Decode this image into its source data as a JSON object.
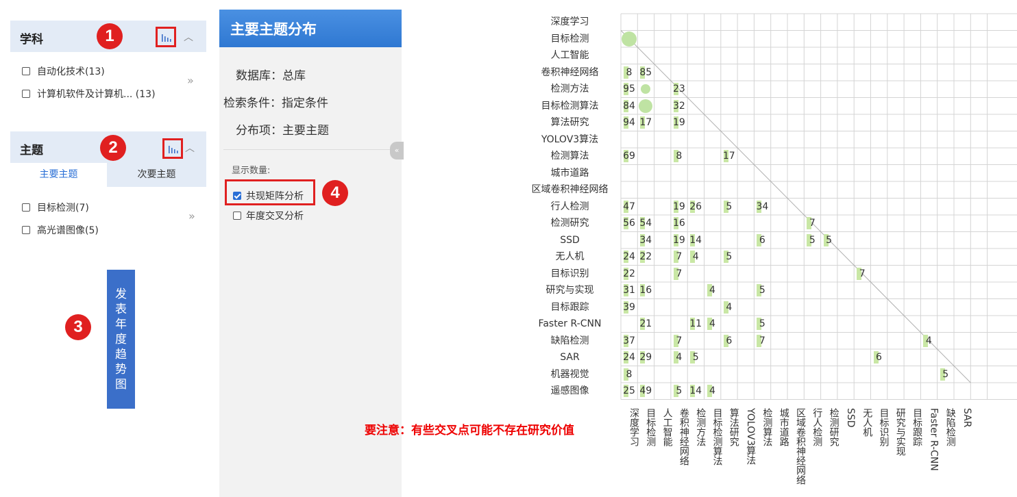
{
  "facets": {
    "subject": {
      "title": "学科",
      "badge": "1",
      "items": [
        "自动化技术(13)",
        "计算机软件及计算机...  (13)"
      ],
      "more": "»"
    },
    "topic": {
      "title": "主题",
      "badge": "2",
      "tabs": [
        "主要主题",
        "次要主题"
      ],
      "items": [
        "目标检测(7)",
        "高光谱图像(5)"
      ],
      "more": "»"
    }
  },
  "trend_badge": "3",
  "trend_button": "发表年度趋势图",
  "panel": {
    "title": "主要主题分布",
    "info": [
      {
        "label": "数据库：",
        "value": "总库"
      },
      {
        "label": "检索条件：",
        "value": "指定条件"
      },
      {
        "label": "分布项：",
        "value": "主要主题"
      }
    ],
    "count_label": "显示数量:",
    "options": [
      {
        "label": "共现矩阵分析",
        "checked": true
      },
      {
        "label": "年度交叉分析",
        "checked": false
      }
    ],
    "option_badge": "4",
    "collapse_icon": "«"
  },
  "matrix": {
    "rows": [
      "深度学习",
      "目标检测",
      "人工智能",
      "卷积神经网络",
      "检测方法",
      "目标检测算法",
      "算法研究",
      "YOLOV3算法",
      "检测算法",
      "城市道路",
      "区域卷积神经网络",
      "行人检测",
      "检测研究",
      "SSD",
      "无人机",
      "目标识别",
      "研究与实现",
      "目标跟踪",
      "Faster R-CNN",
      "缺陷检测",
      "SAR",
      "机器视觉",
      "遥感图像"
    ],
    "columns": [
      "深度学习",
      "目标检测",
      "人工智能",
      "卷积神经网络",
      "检测方法",
      "目标检测算法",
      "算法研究",
      "YOLOV3算法",
      "检测算法",
      "城市道路",
      "区域卷积神经网络",
      "行人检测",
      "检测研究",
      "SSD",
      "无人机",
      "目标识别",
      "研究与实现",
      "目标跟踪",
      "Faster R-CNN",
      "缺陷检测",
      "SAR"
    ],
    "cells": [
      {
        "row": 1,
        "col": 0,
        "value": null
      },
      {
        "row": 3,
        "col": 0,
        "value": "8"
      },
      {
        "row": 3,
        "col": 1,
        "value": "85"
      },
      {
        "row": 4,
        "col": 0,
        "value": "95"
      },
      {
        "row": 4,
        "col": 1,
        "value": null
      },
      {
        "row": 4,
        "col": 3,
        "value": "23"
      },
      {
        "row": 5,
        "col": 0,
        "value": "84"
      },
      {
        "row": 5,
        "col": 1,
        "value": null
      },
      {
        "row": 5,
        "col": 3,
        "value": "32"
      },
      {
        "row": 6,
        "col": 0,
        "value": "94"
      },
      {
        "row": 6,
        "col": 1,
        "value": "17"
      },
      {
        "row": 6,
        "col": 3,
        "value": "19"
      },
      {
        "row": 8,
        "col": 0,
        "value": "69"
      },
      {
        "row": 8,
        "col": 3,
        "value": "8"
      },
      {
        "row": 8,
        "col": 6,
        "value": "17"
      },
      {
        "row": 11,
        "col": 0,
        "value": "47"
      },
      {
        "row": 11,
        "col": 3,
        "value": "19"
      },
      {
        "row": 11,
        "col": 4,
        "value": "26"
      },
      {
        "row": 11,
        "col": 6,
        "value": "5"
      },
      {
        "row": 11,
        "col": 8,
        "value": "34"
      },
      {
        "row": 12,
        "col": 0,
        "value": "56"
      },
      {
        "row": 12,
        "col": 1,
        "value": "54"
      },
      {
        "row": 12,
        "col": 3,
        "value": "16"
      },
      {
        "row": 12,
        "col": 11,
        "value": "7"
      },
      {
        "row": 13,
        "col": 1,
        "value": "34"
      },
      {
        "row": 13,
        "col": 3,
        "value": "19"
      },
      {
        "row": 13,
        "col": 4,
        "value": "14"
      },
      {
        "row": 13,
        "col": 8,
        "value": "6"
      },
      {
        "row": 13,
        "col": 11,
        "value": "5"
      },
      {
        "row": 13,
        "col": 12,
        "value": "5"
      },
      {
        "row": 14,
        "col": 0,
        "value": "24"
      },
      {
        "row": 14,
        "col": 1,
        "value": "22"
      },
      {
        "row": 14,
        "col": 3,
        "value": "7"
      },
      {
        "row": 14,
        "col": 4,
        "value": "4"
      },
      {
        "row": 14,
        "col": 6,
        "value": "5"
      },
      {
        "row": 15,
        "col": 0,
        "value": "22"
      },
      {
        "row": 15,
        "col": 3,
        "value": "7"
      },
      {
        "row": 15,
        "col": 14,
        "value": "7"
      },
      {
        "row": 16,
        "col": 0,
        "value": "31"
      },
      {
        "row": 16,
        "col": 1,
        "value": "16"
      },
      {
        "row": 16,
        "col": 5,
        "value": "4"
      },
      {
        "row": 16,
        "col": 8,
        "value": "5"
      },
      {
        "row": 17,
        "col": 0,
        "value": "39"
      },
      {
        "row": 17,
        "col": 6,
        "value": "4"
      },
      {
        "row": 18,
        "col": 1,
        "value": "21"
      },
      {
        "row": 18,
        "col": 4,
        "value": "11"
      },
      {
        "row": 18,
        "col": 5,
        "value": "4"
      },
      {
        "row": 18,
        "col": 8,
        "value": "5"
      },
      {
        "row": 19,
        "col": 0,
        "value": "37"
      },
      {
        "row": 19,
        "col": 3,
        "value": "7"
      },
      {
        "row": 19,
        "col": 6,
        "value": "6"
      },
      {
        "row": 19,
        "col": 8,
        "value": "7"
      },
      {
        "row": 19,
        "col": 18,
        "value": "4"
      },
      {
        "row": 20,
        "col": 0,
        "value": "24"
      },
      {
        "row": 20,
        "col": 1,
        "value": "29"
      },
      {
        "row": 20,
        "col": 3,
        "value": "4"
      },
      {
        "row": 20,
        "col": 4,
        "value": "5"
      },
      {
        "row": 20,
        "col": 15,
        "value": "6"
      },
      {
        "row": 21,
        "col": 0,
        "value": "8"
      },
      {
        "row": 21,
        "col": 19,
        "value": "5"
      },
      {
        "row": 22,
        "col": 0,
        "value": "25"
      },
      {
        "row": 22,
        "col": 1,
        "value": "49"
      },
      {
        "row": 22,
        "col": 3,
        "value": "5"
      },
      {
        "row": 22,
        "col": 4,
        "value": "14"
      },
      {
        "row": 22,
        "col": 5,
        "value": "4"
      }
    ],
    "colors": {
      "bubble": "#bfe3a3",
      "grid": "#d4d4d4"
    }
  },
  "warning": "要注意：有些交叉点可能不存在研究价值"
}
